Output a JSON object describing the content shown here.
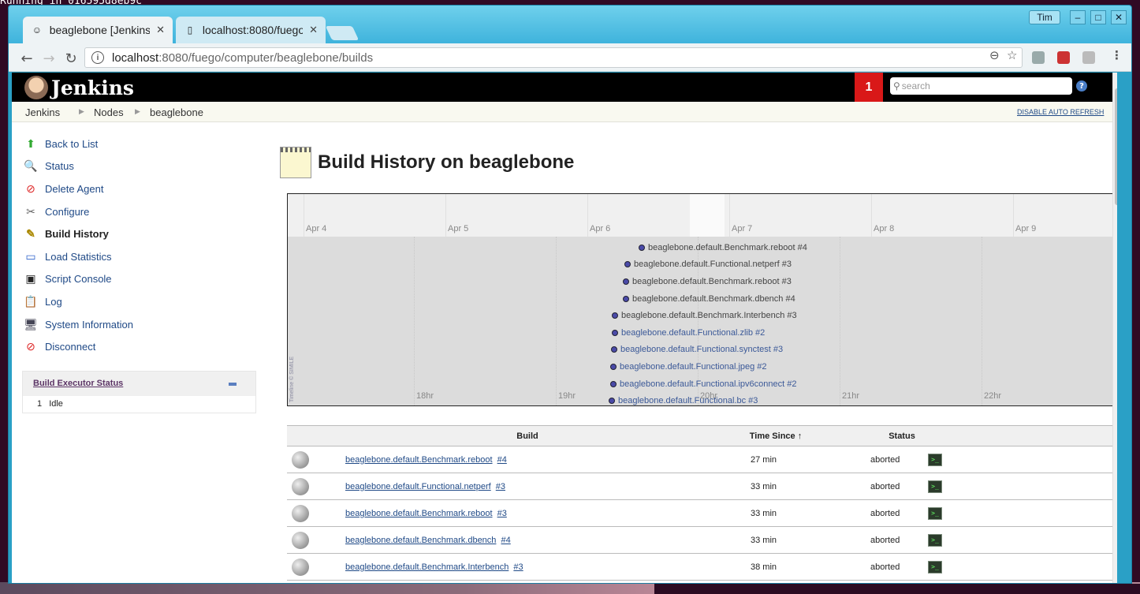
{
  "terminal_text": "Running in 016595d8eb9c",
  "window": {
    "user_label": "Tim",
    "tabs": [
      {
        "label": "beaglebone [Jenkins",
        "active": true
      },
      {
        "label": "localhost:8080/fuego",
        "active": false
      }
    ]
  },
  "address_bar": {
    "host": "localhost",
    "path": ":8080/fuego/computer/beaglebone/builds"
  },
  "header": {
    "logo_text": "Jenkins",
    "notification_count": "1",
    "search_placeholder": "search",
    "help_label": "?"
  },
  "breadcrumbs": {
    "items": [
      "Jenkins",
      "Nodes",
      "beaglebone"
    ],
    "auto_refresh": "DISABLE AUTO REFRESH"
  },
  "sidebar": {
    "items": [
      {
        "label": "Back to List",
        "icon": "up-arrow-icon"
      },
      {
        "label": "Status",
        "icon": "magnifier-icon"
      },
      {
        "label": "Delete Agent",
        "icon": "no-entry-icon"
      },
      {
        "label": "Configure",
        "icon": "tools-icon"
      },
      {
        "label": "Build History",
        "icon": "notepad-icon",
        "active": true
      },
      {
        "label": "Load Statistics",
        "icon": "monitor-graph-icon"
      },
      {
        "label": "Script Console",
        "icon": "terminal-icon"
      },
      {
        "label": "Log",
        "icon": "clipboard-icon"
      },
      {
        "label": "System Information",
        "icon": "computer-icon"
      },
      {
        "label": "Disconnect",
        "icon": "no-entry-icon"
      }
    ],
    "executor": {
      "title": "Build Executor Status",
      "rows": [
        {
          "num": "1",
          "state": "Idle"
        }
      ]
    }
  },
  "main": {
    "title": "Build History on beaglebone"
  },
  "timeline": {
    "days": [
      "Apr 4",
      "Apr 5",
      "Apr 6",
      "Apr 7",
      "Apr 8",
      "Apr 9"
    ],
    "hours": [
      "18hr",
      "19hr",
      "20hr",
      "21hr",
      "22hr"
    ],
    "credit": "Timeline © SIMILE",
    "events": [
      "beaglebone.default.Benchmark.reboot #4",
      "beaglebone.default.Functional.netperf #3",
      "beaglebone.default.Benchmark.reboot #3",
      "beaglebone.default.Benchmark.dbench #4",
      "beaglebone.default.Benchmark.Interbench #3",
      "beaglebone.default.Functional.zlib #2",
      "beaglebone.default.Functional.synctest #3",
      "beaglebone.default.Functional.jpeg #2",
      "beaglebone.default.Functional.ipv6connect #2",
      "beaglebone.default.Functional.bc #3"
    ]
  },
  "builds_table": {
    "headers": {
      "build": "Build",
      "time_since": "Time Since",
      "sort_arrow": "↑",
      "status": "Status"
    },
    "rows": [
      {
        "job": "beaglebone.default.Benchmark.reboot",
        "num": "#4",
        "time": "27 min",
        "status": "aborted"
      },
      {
        "job": "beaglebone.default.Functional.netperf",
        "num": "#3",
        "time": "33 min",
        "status": "aborted"
      },
      {
        "job": "beaglebone.default.Benchmark.reboot",
        "num": "#3",
        "time": "33 min",
        "status": "aborted"
      },
      {
        "job": "beaglebone.default.Benchmark.dbench",
        "num": "#4",
        "time": "33 min",
        "status": "aborted"
      },
      {
        "job": "beaglebone.default.Benchmark.Interbench",
        "num": "#3",
        "time": "38 min",
        "status": "aborted"
      }
    ]
  }
}
